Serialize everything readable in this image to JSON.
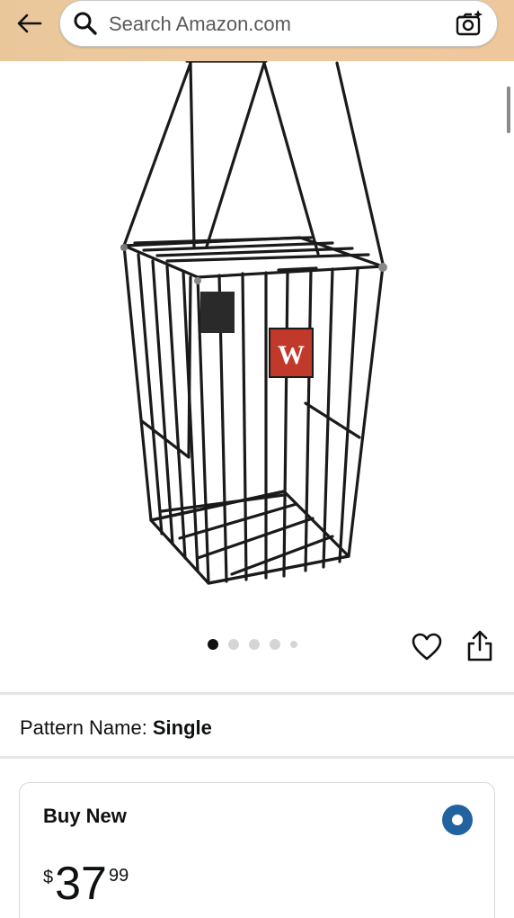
{
  "header": {
    "search_placeholder": "Search Amazon.com"
  },
  "icons": {
    "back": "arrow-left-icon",
    "search": "search-icon",
    "camera": "camera-sparkle-icon",
    "wishlist": "heart-icon",
    "share": "share-icon"
  },
  "gallery": {
    "image_count": 5,
    "active_index": 0
  },
  "variation": {
    "label": "Pattern Name:",
    "value": "Single"
  },
  "buy_box": {
    "title": "Buy New",
    "price_symbol": "$",
    "price_whole": "37",
    "price_fraction": "99",
    "selected": true
  },
  "colors": {
    "header_bg": "#eec9a0",
    "radio_selected": "#2162a1",
    "divider": "#e3e6e6"
  }
}
